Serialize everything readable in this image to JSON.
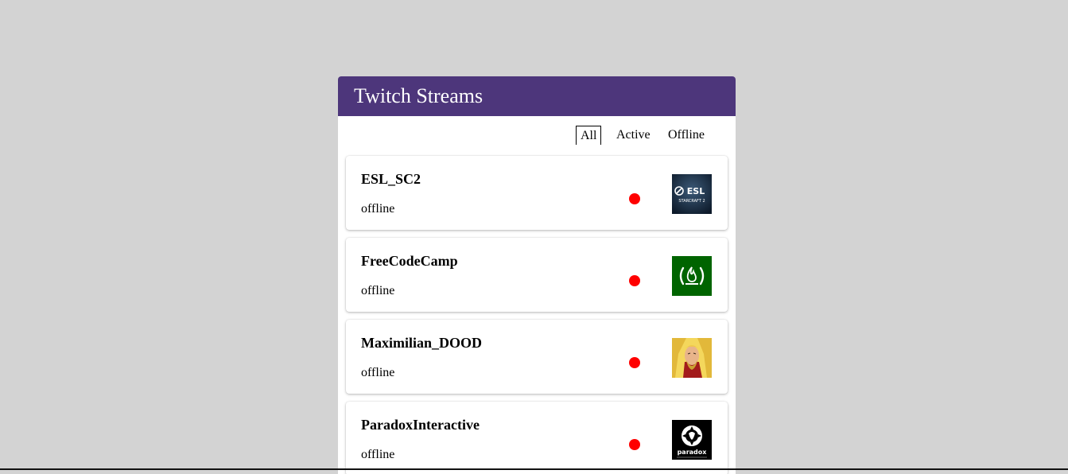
{
  "header": {
    "title": "Twitch Streams"
  },
  "filters": [
    {
      "label": "All",
      "selected": true
    },
    {
      "label": "Active",
      "selected": false
    },
    {
      "label": "Offline",
      "selected": false
    }
  ],
  "streams": [
    {
      "name": "ESL_SC2",
      "status": "offline",
      "status_color": "#ff0000",
      "logo_icon": "esl-starcraft-logo",
      "logo_text": [
        "ESL",
        "STARCRAFT 2"
      ]
    },
    {
      "name": "FreeCodeCamp",
      "status": "offline",
      "status_color": "#ff0000",
      "logo_icon": "freecodecamp-logo"
    },
    {
      "name": "Maximilian_DOOD",
      "status": "offline",
      "status_color": "#ff0000",
      "logo_icon": "maximilian-avatar"
    },
    {
      "name": "ParadoxInteractive",
      "status": "offline",
      "status_color": "#ff0000",
      "logo_icon": "paradox-logo",
      "logo_text": [
        "paradox"
      ]
    }
  ],
  "colors": {
    "header_bg": "#4d367b",
    "page_bg": "#d3d3d3",
    "offline_dot": "#ff0000"
  }
}
